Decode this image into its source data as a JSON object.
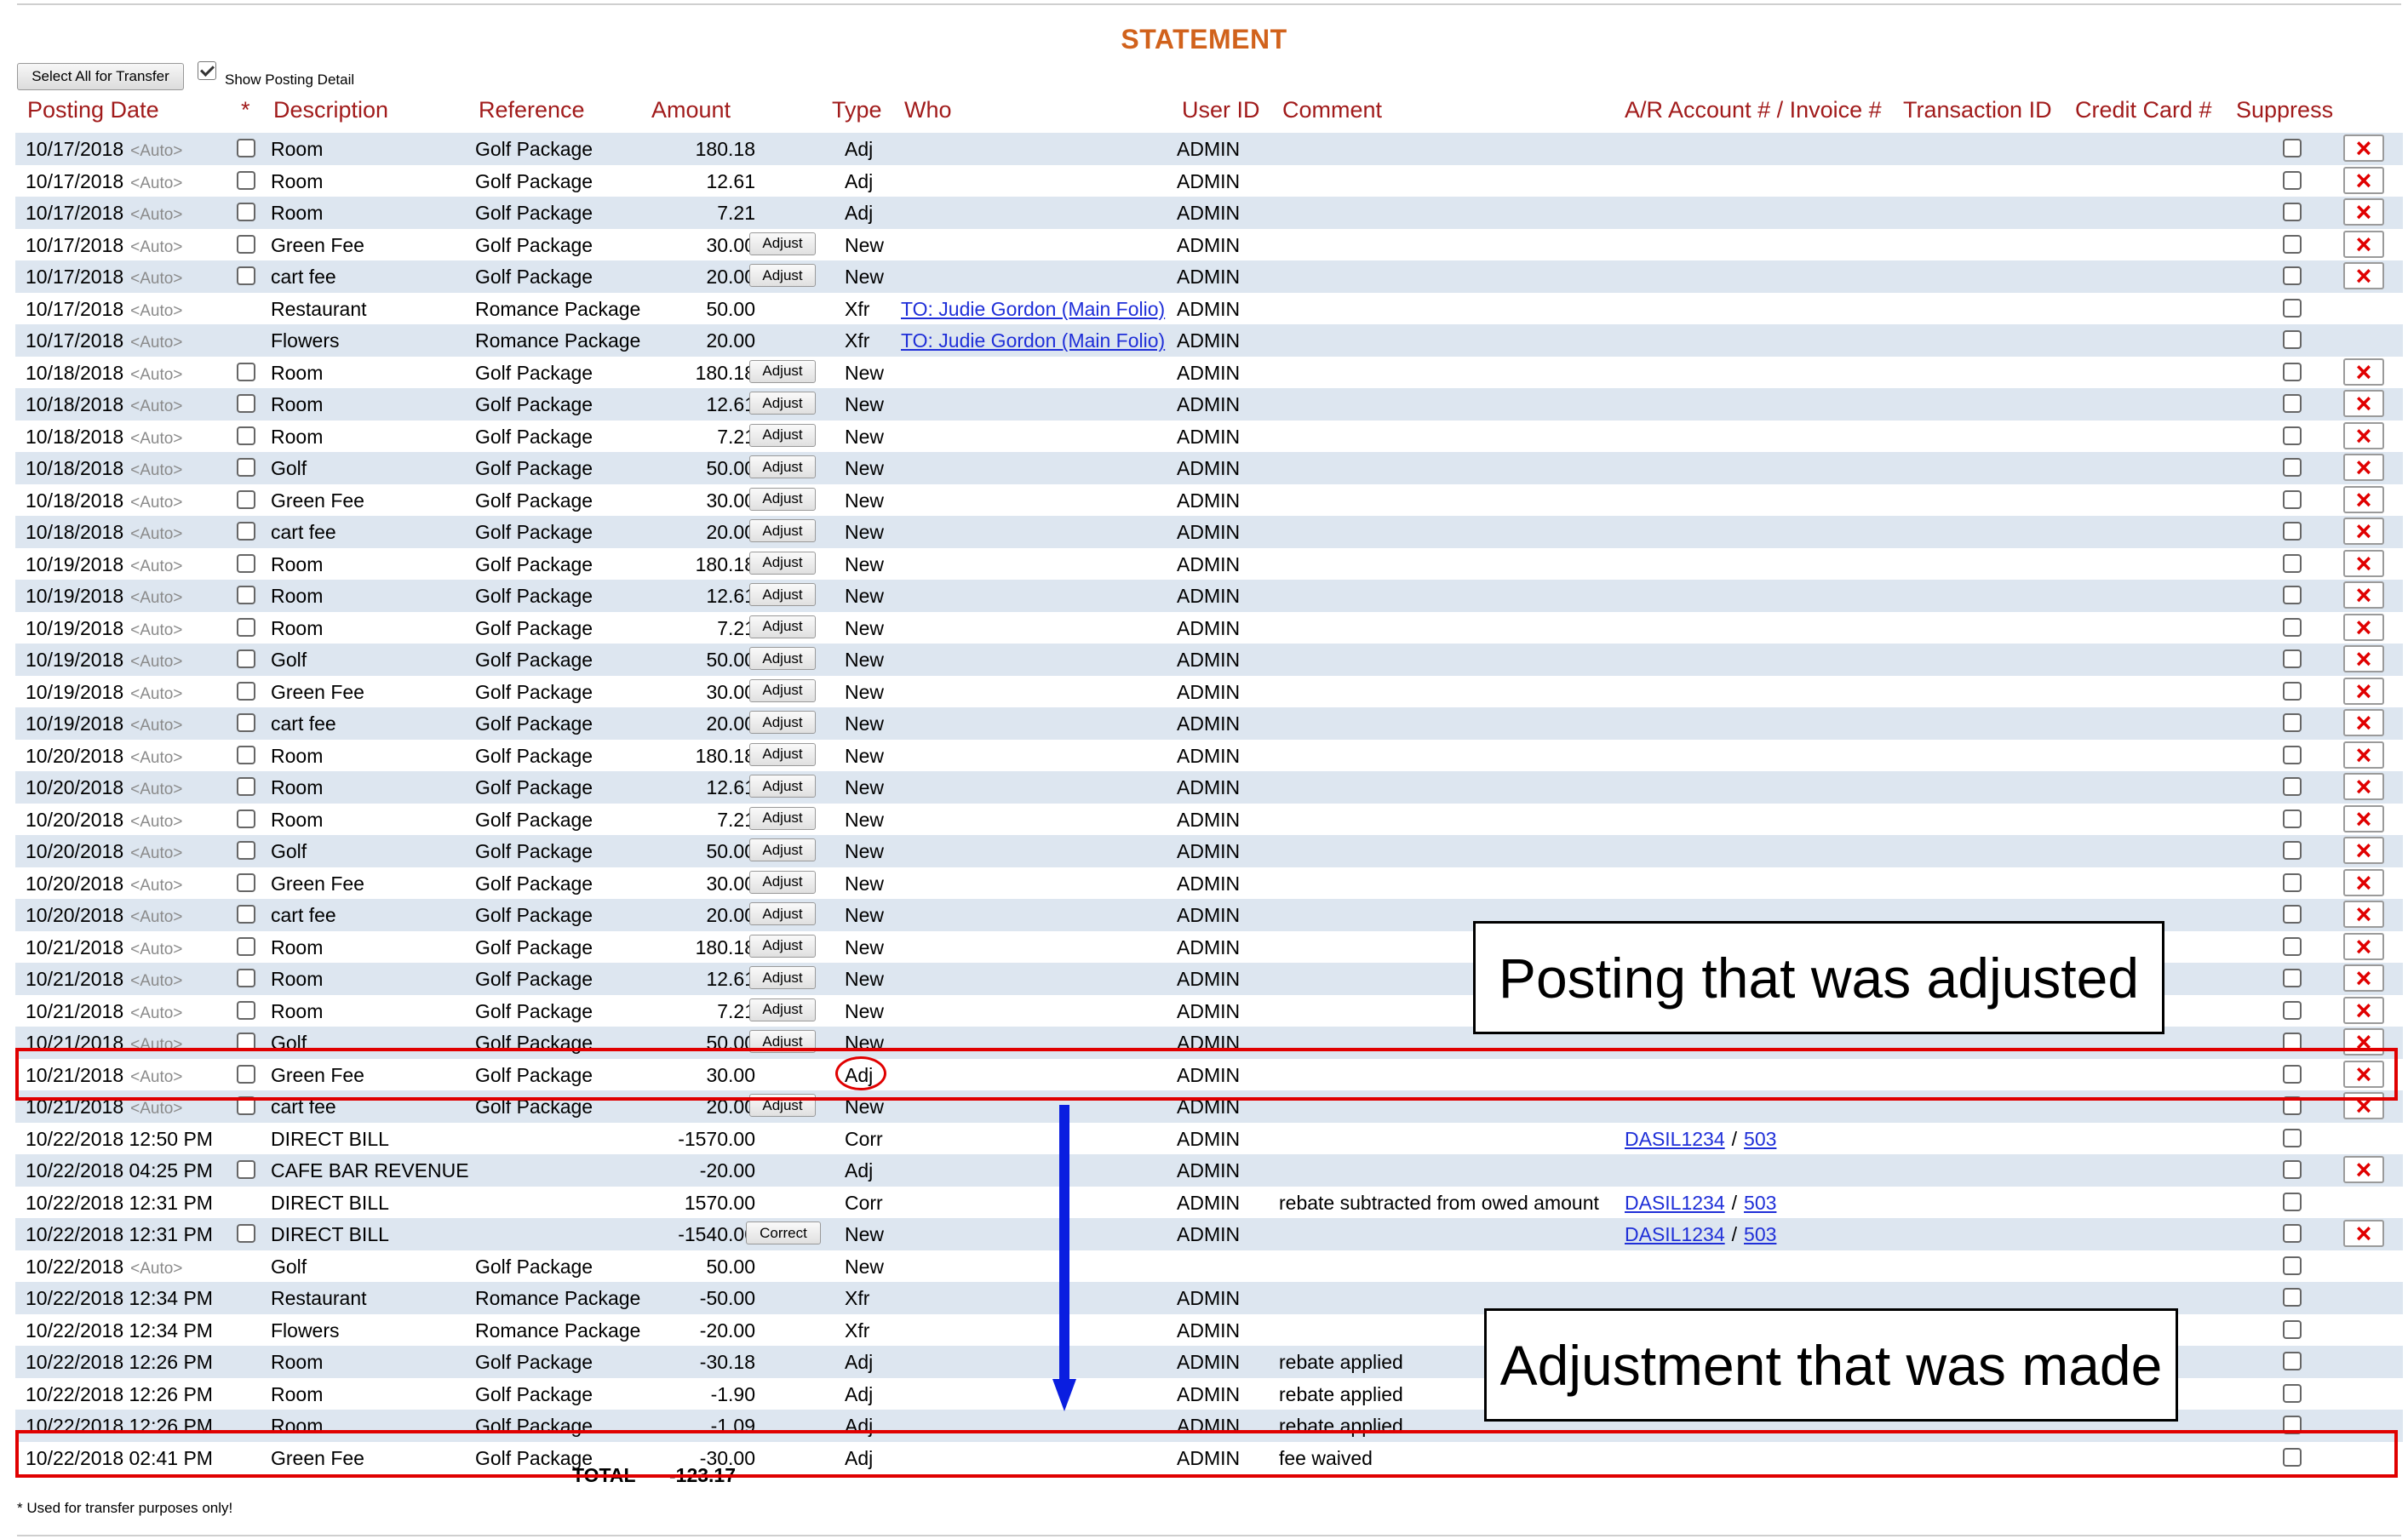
{
  "title": "STATEMENT",
  "select_all_label": "Select All for Transfer",
  "show_posting_detail_label": "Show Posting Detail",
  "columns": {
    "posting_date": "Posting Date",
    "star": "*",
    "description": "Description",
    "reference": "Reference",
    "amount": "Amount",
    "type": "Type",
    "who": "Who",
    "user_id": "User ID",
    "comment": "Comment",
    "ar_account": "A/R Account # / Invoice #",
    "transaction_id": "Transaction ID",
    "credit_card": "Credit Card #",
    "suppress": "Suppress"
  },
  "auto_tag": "<Auto>",
  "slash": "/",
  "rows": [
    {
      "date": "10/17/2018",
      "auto": true,
      "cb": true,
      "desc": "Room",
      "ref": "Golf Package",
      "amount": "180.18",
      "btn": "",
      "type": "Adj",
      "who": "",
      "user": "ADMIN",
      "comment": "",
      "ar": "",
      "inv": "",
      "x": true
    },
    {
      "date": "10/17/2018",
      "auto": true,
      "cb": true,
      "desc": "Room",
      "ref": "Golf Package",
      "amount": "12.61",
      "btn": "",
      "type": "Adj",
      "who": "",
      "user": "ADMIN",
      "comment": "",
      "ar": "",
      "inv": "",
      "x": true
    },
    {
      "date": "10/17/2018",
      "auto": true,
      "cb": true,
      "desc": "Room",
      "ref": "Golf Package",
      "amount": "7.21",
      "btn": "",
      "type": "Adj",
      "who": "",
      "user": "ADMIN",
      "comment": "",
      "ar": "",
      "inv": "",
      "x": true
    },
    {
      "date": "10/17/2018",
      "auto": true,
      "cb": true,
      "desc": "Green Fee",
      "ref": "Golf Package",
      "amount": "30.00",
      "btn": "Adjust",
      "type": "New",
      "who": "",
      "user": "ADMIN",
      "comment": "",
      "ar": "",
      "inv": "",
      "x": true
    },
    {
      "date": "10/17/2018",
      "auto": true,
      "cb": true,
      "desc": "cart fee",
      "ref": "Golf Package",
      "amount": "20.00",
      "btn": "Adjust",
      "type": "New",
      "who": "",
      "user": "ADMIN",
      "comment": "",
      "ar": "",
      "inv": "",
      "x": true
    },
    {
      "date": "10/17/2018",
      "auto": true,
      "cb": false,
      "desc": "Restaurant",
      "ref": "Romance Package",
      "amount": "50.00",
      "btn": "",
      "type": "Xfr",
      "who": "TO: Judie Gordon (Main Folio)",
      "user": "ADMIN",
      "comment": "",
      "ar": "",
      "inv": "",
      "x": false
    },
    {
      "date": "10/17/2018",
      "auto": true,
      "cb": false,
      "desc": "Flowers",
      "ref": "Romance Package",
      "amount": "20.00",
      "btn": "",
      "type": "Xfr",
      "who": "TO: Judie Gordon (Main Folio)",
      "user": "ADMIN",
      "comment": "",
      "ar": "",
      "inv": "",
      "x": false
    },
    {
      "date": "10/18/2018",
      "auto": true,
      "cb": true,
      "desc": "Room",
      "ref": "Golf Package",
      "amount": "180.18",
      "btn": "Adjust",
      "type": "New",
      "who": "",
      "user": "ADMIN",
      "comment": "",
      "ar": "",
      "inv": "",
      "x": true
    },
    {
      "date": "10/18/2018",
      "auto": true,
      "cb": true,
      "desc": "Room",
      "ref": "Golf Package",
      "amount": "12.61",
      "btn": "Adjust",
      "type": "New",
      "who": "",
      "user": "ADMIN",
      "comment": "",
      "ar": "",
      "inv": "",
      "x": true
    },
    {
      "date": "10/18/2018",
      "auto": true,
      "cb": true,
      "desc": "Room",
      "ref": "Golf Package",
      "amount": "7.21",
      "btn": "Adjust",
      "type": "New",
      "who": "",
      "user": "ADMIN",
      "comment": "",
      "ar": "",
      "inv": "",
      "x": true
    },
    {
      "date": "10/18/2018",
      "auto": true,
      "cb": true,
      "desc": "Golf",
      "ref": "Golf Package",
      "amount": "50.00",
      "btn": "Adjust",
      "type": "New",
      "who": "",
      "user": "ADMIN",
      "comment": "",
      "ar": "",
      "inv": "",
      "x": true
    },
    {
      "date": "10/18/2018",
      "auto": true,
      "cb": true,
      "desc": "Green Fee",
      "ref": "Golf Package",
      "amount": "30.00",
      "btn": "Adjust",
      "type": "New",
      "who": "",
      "user": "ADMIN",
      "comment": "",
      "ar": "",
      "inv": "",
      "x": true
    },
    {
      "date": "10/18/2018",
      "auto": true,
      "cb": true,
      "desc": "cart fee",
      "ref": "Golf Package",
      "amount": "20.00",
      "btn": "Adjust",
      "type": "New",
      "who": "",
      "user": "ADMIN",
      "comment": "",
      "ar": "",
      "inv": "",
      "x": true
    },
    {
      "date": "10/19/2018",
      "auto": true,
      "cb": true,
      "desc": "Room",
      "ref": "Golf Package",
      "amount": "180.18",
      "btn": "Adjust",
      "type": "New",
      "who": "",
      "user": "ADMIN",
      "comment": "",
      "ar": "",
      "inv": "",
      "x": true
    },
    {
      "date": "10/19/2018",
      "auto": true,
      "cb": true,
      "desc": "Room",
      "ref": "Golf Package",
      "amount": "12.61",
      "btn": "Adjust",
      "type": "New",
      "who": "",
      "user": "ADMIN",
      "comment": "",
      "ar": "",
      "inv": "",
      "x": true
    },
    {
      "date": "10/19/2018",
      "auto": true,
      "cb": true,
      "desc": "Room",
      "ref": "Golf Package",
      "amount": "7.21",
      "btn": "Adjust",
      "type": "New",
      "who": "",
      "user": "ADMIN",
      "comment": "",
      "ar": "",
      "inv": "",
      "x": true
    },
    {
      "date": "10/19/2018",
      "auto": true,
      "cb": true,
      "desc": "Golf",
      "ref": "Golf Package",
      "amount": "50.00",
      "btn": "Adjust",
      "type": "New",
      "who": "",
      "user": "ADMIN",
      "comment": "",
      "ar": "",
      "inv": "",
      "x": true
    },
    {
      "date": "10/19/2018",
      "auto": true,
      "cb": true,
      "desc": "Green Fee",
      "ref": "Golf Package",
      "amount": "30.00",
      "btn": "Adjust",
      "type": "New",
      "who": "",
      "user": "ADMIN",
      "comment": "",
      "ar": "",
      "inv": "",
      "x": true
    },
    {
      "date": "10/19/2018",
      "auto": true,
      "cb": true,
      "desc": "cart fee",
      "ref": "Golf Package",
      "amount": "20.00",
      "btn": "Adjust",
      "type": "New",
      "who": "",
      "user": "ADMIN",
      "comment": "",
      "ar": "",
      "inv": "",
      "x": true
    },
    {
      "date": "10/20/2018",
      "auto": true,
      "cb": true,
      "desc": "Room",
      "ref": "Golf Package",
      "amount": "180.18",
      "btn": "Adjust",
      "type": "New",
      "who": "",
      "user": "ADMIN",
      "comment": "",
      "ar": "",
      "inv": "",
      "x": true
    },
    {
      "date": "10/20/2018",
      "auto": true,
      "cb": true,
      "desc": "Room",
      "ref": "Golf Package",
      "amount": "12.61",
      "btn": "Adjust",
      "type": "New",
      "who": "",
      "user": "ADMIN",
      "comment": "",
      "ar": "",
      "inv": "",
      "x": true
    },
    {
      "date": "10/20/2018",
      "auto": true,
      "cb": true,
      "desc": "Room",
      "ref": "Golf Package",
      "amount": "7.21",
      "btn": "Adjust",
      "type": "New",
      "who": "",
      "user": "ADMIN",
      "comment": "",
      "ar": "",
      "inv": "",
      "x": true
    },
    {
      "date": "10/20/2018",
      "auto": true,
      "cb": true,
      "desc": "Golf",
      "ref": "Golf Package",
      "amount": "50.00",
      "btn": "Adjust",
      "type": "New",
      "who": "",
      "user": "ADMIN",
      "comment": "",
      "ar": "",
      "inv": "",
      "x": true
    },
    {
      "date": "10/20/2018",
      "auto": true,
      "cb": true,
      "desc": "Green Fee",
      "ref": "Golf Package",
      "amount": "30.00",
      "btn": "Adjust",
      "type": "New",
      "who": "",
      "user": "ADMIN",
      "comment": "",
      "ar": "",
      "inv": "",
      "x": true
    },
    {
      "date": "10/20/2018",
      "auto": true,
      "cb": true,
      "desc": "cart fee",
      "ref": "Golf Package",
      "amount": "20.00",
      "btn": "Adjust",
      "type": "New",
      "who": "",
      "user": "ADMIN",
      "comment": "",
      "ar": "",
      "inv": "",
      "x": true
    },
    {
      "date": "10/21/2018",
      "auto": true,
      "cb": true,
      "desc": "Room",
      "ref": "Golf Package",
      "amount": "180.18",
      "btn": "Adjust",
      "type": "New",
      "who": "",
      "user": "ADMIN",
      "comment": "",
      "ar": "",
      "inv": "",
      "x": true
    },
    {
      "date": "10/21/2018",
      "auto": true,
      "cb": true,
      "desc": "Room",
      "ref": "Golf Package",
      "amount": "12.61",
      "btn": "Adjust",
      "type": "New",
      "who": "",
      "user": "ADMIN",
      "comment": "",
      "ar": "",
      "inv": "",
      "x": true
    },
    {
      "date": "10/21/2018",
      "auto": true,
      "cb": true,
      "desc": "Room",
      "ref": "Golf Package",
      "amount": "7.21",
      "btn": "Adjust",
      "type": "New",
      "who": "",
      "user": "ADMIN",
      "comment": "",
      "ar": "",
      "inv": "",
      "x": true
    },
    {
      "date": "10/21/2018",
      "auto": true,
      "cb": true,
      "desc": "Golf",
      "ref": "Golf Package",
      "amount": "50.00",
      "btn": "Adjust",
      "type": "New",
      "who": "",
      "user": "ADMIN",
      "comment": "",
      "ar": "",
      "inv": "",
      "x": true
    },
    {
      "date": "10/21/2018",
      "auto": true,
      "cb": true,
      "desc": "Green Fee",
      "ref": "Golf Package",
      "amount": "30.00",
      "btn": "",
      "type": "Adj",
      "who": "",
      "user": "ADMIN",
      "comment": "",
      "ar": "",
      "inv": "",
      "x": true,
      "circled": true
    },
    {
      "date": "10/21/2018",
      "auto": true,
      "cb": true,
      "desc": "cart fee",
      "ref": "Golf Package",
      "amount": "20.00",
      "btn": "Adjust",
      "type": "New",
      "who": "",
      "user": "ADMIN",
      "comment": "",
      "ar": "",
      "inv": "",
      "x": true
    },
    {
      "date": "10/22/2018 12:50 PM",
      "auto": false,
      "cb": false,
      "desc": "DIRECT BILL",
      "ref": "",
      "amount": "-1570.00",
      "btn": "",
      "type": "Corr",
      "who": "",
      "user": "ADMIN",
      "comment": "",
      "ar": "DASIL1234",
      "inv": "503",
      "x": false
    },
    {
      "date": "10/22/2018 04:25 PM",
      "auto": false,
      "cb": true,
      "desc": "CAFE BAR REVENUE",
      "ref": "",
      "amount": "-20.00",
      "btn": "",
      "type": "Adj",
      "who": "",
      "user": "ADMIN",
      "comment": "",
      "ar": "",
      "inv": "",
      "x": true
    },
    {
      "date": "10/22/2018 12:31 PM",
      "auto": false,
      "cb": false,
      "desc": "DIRECT BILL",
      "ref": "",
      "amount": "1570.00",
      "btn": "",
      "type": "Corr",
      "who": "",
      "user": "ADMIN",
      "comment": "rebate subtracted from owed amount",
      "ar": "DASIL1234",
      "inv": "503",
      "x": false
    },
    {
      "date": "10/22/2018 12:31 PM",
      "auto": false,
      "cb": true,
      "desc": "DIRECT BILL",
      "ref": "",
      "amount": "-1540.00",
      "btn": "Correct",
      "type": "New",
      "who": "",
      "user": "ADMIN",
      "comment": "",
      "ar": "DASIL1234",
      "inv": "503",
      "x": true
    },
    {
      "date": "10/22/2018",
      "auto": true,
      "cb": false,
      "desc": "Golf",
      "ref": "Golf Package",
      "amount": "50.00",
      "btn": "",
      "type": "New",
      "who": "",
      "user": "",
      "comment": "",
      "ar": "",
      "inv": "",
      "x": false
    },
    {
      "date": "10/22/2018 12:34 PM",
      "auto": false,
      "cb": false,
      "desc": "Restaurant",
      "ref": "Romance Package",
      "amount": "-50.00",
      "btn": "",
      "type": "Xfr",
      "who": "",
      "user": "ADMIN",
      "comment": "",
      "ar": "",
      "inv": "",
      "x": false
    },
    {
      "date": "10/22/2018 12:34 PM",
      "auto": false,
      "cb": false,
      "desc": "Flowers",
      "ref": "Romance Package",
      "amount": "-20.00",
      "btn": "",
      "type": "Xfr",
      "who": "",
      "user": "ADMIN",
      "comment": "",
      "ar": "",
      "inv": "",
      "x": false
    },
    {
      "date": "10/22/2018 12:26 PM",
      "auto": false,
      "cb": false,
      "desc": "Room",
      "ref": "Golf Package",
      "amount": "-30.18",
      "btn": "",
      "type": "Adj",
      "who": "",
      "user": "ADMIN",
      "comment": "rebate applied",
      "ar": "",
      "inv": "",
      "x": false
    },
    {
      "date": "10/22/2018 12:26 PM",
      "auto": false,
      "cb": false,
      "desc": "Room",
      "ref": "Golf Package",
      "amount": "-1.90",
      "btn": "",
      "type": "Adj",
      "who": "",
      "user": "ADMIN",
      "comment": "rebate applied",
      "ar": "",
      "inv": "",
      "x": false
    },
    {
      "date": "10/22/2018 12:26 PM",
      "auto": false,
      "cb": false,
      "desc": "Room",
      "ref": "Golf Package",
      "amount": "-1.09",
      "btn": "",
      "type": "Adj",
      "who": "",
      "user": "ADMIN",
      "comment": "rebate applied",
      "ar": "",
      "inv": "",
      "x": false
    },
    {
      "date": "10/22/2018 02:41 PM",
      "auto": false,
      "cb": false,
      "desc": "Green Fee",
      "ref": "Golf Package",
      "amount": "-30.00",
      "btn": "",
      "type": "Adj",
      "who": "",
      "user": "ADMIN",
      "comment": "fee waived",
      "ar": "",
      "inv": "",
      "x": false
    }
  ],
  "total": {
    "label": "TOTAL",
    "amount": "-123.17"
  },
  "footnote": "* Used for transfer purposes only!",
  "annotations": {
    "adjusted": "Posting that was adjusted",
    "adjustment": "Adjustment that was made"
  },
  "colors": {
    "accent": "#d1621c",
    "header": "#a11b1b",
    "row_shade": "#dde6f0",
    "link": "#1f2fd8",
    "highlight": "#e00000",
    "arrow": "#0a1ee0"
  }
}
